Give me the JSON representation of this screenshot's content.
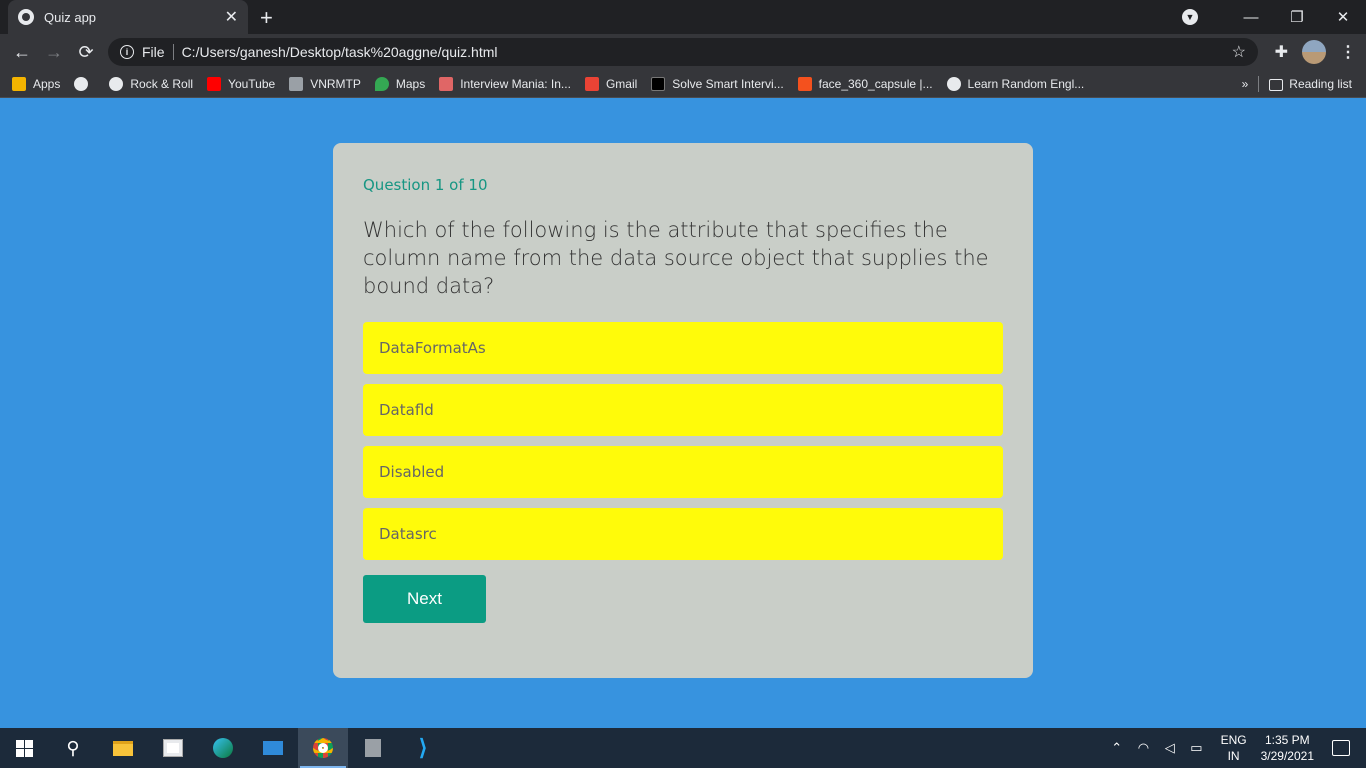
{
  "browser": {
    "tab_title": "Quiz app",
    "tab_close": "✕",
    "new_tab": "+",
    "file_label": "File",
    "url": "C:/Users/ganesh/Desktop/task%20aggne/quiz.html",
    "bookmarks": [
      {
        "label": "Apps",
        "icon": "apps-grid-icon",
        "color": "#f4b400"
      },
      {
        "label": "",
        "icon": "globe-icon",
        "color": "#e8eaed"
      },
      {
        "label": "Rock & Roll",
        "icon": "globe-icon",
        "color": "#e8eaed"
      },
      {
        "label": "YouTube",
        "icon": "youtube-icon",
        "color": "#ff0000"
      },
      {
        "label": "VNRMTP",
        "icon": "vnr-icon",
        "color": "#9aa0a6"
      },
      {
        "label": "Maps",
        "icon": "maps-pin-icon",
        "color": "#34a853"
      },
      {
        "label": "Interview Mania: In...",
        "icon": "interview-mania-icon",
        "color": "#e06666"
      },
      {
        "label": "Gmail",
        "icon": "gmail-icon",
        "color": "#ea4335"
      },
      {
        "label": "Solve Smart Intervi...",
        "icon": "solve-smart-icon",
        "color": "#000000"
      },
      {
        "label": "face_360_capsule |...",
        "icon": "face360-icon",
        "color": "#f4511e"
      },
      {
        "label": "Learn Random Engl...",
        "icon": "wordpress-icon",
        "color": "#e8eaed"
      }
    ],
    "overflow": "»",
    "reading_list": "Reading list"
  },
  "quiz": {
    "counter": "Question 1 of 10",
    "question": "Which of the following is the attribute that specifies the column name from the data source object that supplies the bound data?",
    "options": [
      "DataFormatAs",
      "Datafld",
      "Disabled",
      "Datasrc"
    ],
    "next_label": "Next"
  },
  "taskbar": {
    "lang_top": "ENG",
    "lang_bottom": "IN",
    "time": "1:35 PM",
    "date": "3/29/2021"
  },
  "colors": {
    "page_bg": "#3793df",
    "card_bg": "#c9cec8",
    "option_bg": "#fffb0a",
    "accent": "#179683",
    "button_bg": "#0b9c83"
  }
}
